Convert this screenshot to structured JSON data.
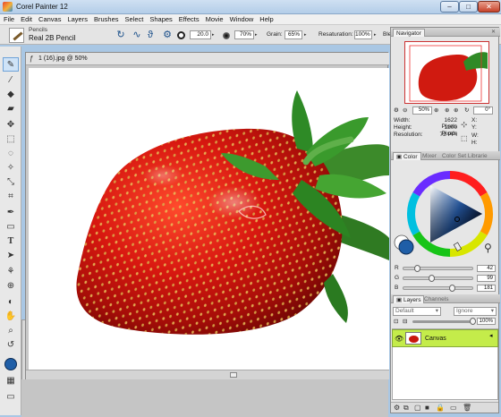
{
  "app": {
    "title": "Corel Painter 12"
  },
  "window_controls": {
    "minimize": "–",
    "maximize": "□",
    "close": "✕"
  },
  "menu": [
    "File",
    "Edit",
    "Canvas",
    "Layers",
    "Brushes",
    "Select",
    "Shapes",
    "Effects",
    "Movie",
    "Window",
    "Help"
  ],
  "property_bar": {
    "brush_category": "Pencils",
    "brush_variant": "Real 2B Pencil",
    "size_value": "20.0",
    "opacity_value": "70%",
    "grain_label": "Grain:",
    "grain_value": "65%",
    "resaturation_label": "Resaturation:",
    "resaturation_value": "100%",
    "bleed_label": "Ble"
  },
  "document": {
    "title": "1 (16).jpg @ 50%"
  },
  "navigator": {
    "tab": "Navigator",
    "zoom_value": "50%",
    "rotation_value": "0°",
    "width_label": "Width:",
    "width_value": "1622 Pixels",
    "height_label": "Height:",
    "height_value": "1200 Pixels",
    "resolution_label": "Resolution:",
    "resolution_value": "72 PPI",
    "x_label": "X:",
    "y_label": "Y:",
    "w_label": "W:",
    "h_label": "H:"
  },
  "color_panel": {
    "tabs": [
      "Color",
      "Mixer",
      "Color Set Librarie"
    ],
    "current_color": "#1f5ea7",
    "r_label": "R",
    "r_value": "42",
    "g_label": "G",
    "g_value": "99",
    "b_label": "B",
    "b_value": "181",
    "r_level": 0.16,
    "g_level": 0.39,
    "b_level": 0.71
  },
  "layers_panel": {
    "tabs": [
      "Layers",
      "Channels"
    ],
    "composite_method": "Default",
    "preserve_mode": "Ignore",
    "opacity_value": "100%",
    "layer_name": "Canvas"
  },
  "colors": {
    "selected_layer": "#c4ec4a",
    "accent_blue": "#1f5ea7",
    "strawberry_red": "#c8160d"
  }
}
